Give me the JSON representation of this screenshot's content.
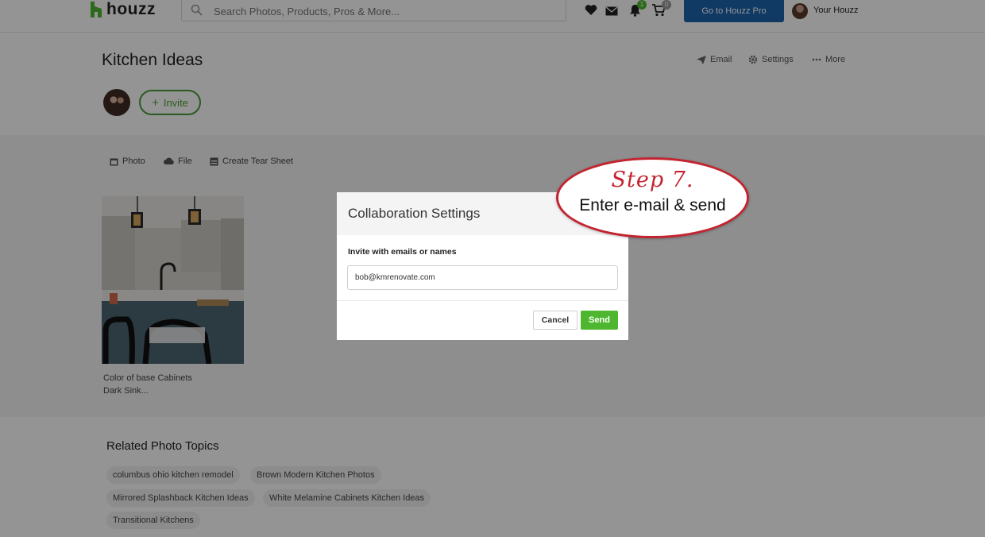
{
  "header": {
    "logo_text": "houzz",
    "search_placeholder": "Search Photos, Products, Pros & More...",
    "notifications_count": "1",
    "cart_count": "0",
    "pro_button": "Go to Houzz Pro",
    "user_label": "Your Houzz"
  },
  "page": {
    "title": "Kitchen Ideas",
    "actions": {
      "email": "Email",
      "settings": "Settings",
      "more": "More"
    },
    "invite_label": "Invite"
  },
  "toolbar": {
    "photo": "Photo",
    "file": "File",
    "tear_sheet": "Create Tear Sheet"
  },
  "photo_card": {
    "caption_line1": "Color of base Cabinets",
    "caption_line2": "Dark Sink..."
  },
  "related": {
    "title": "Related Photo Topics",
    "topics": [
      "columbus ohio kitchen remodel",
      "Brown Modern Kitchen Photos",
      "Mirrored Splashback Kitchen Ideas",
      "White Melamine Cabinets Kitchen Ideas",
      "Transitional Kitchens"
    ]
  },
  "modal": {
    "title": "Collaboration Settings",
    "label": "Invite with emails or names",
    "input_value": "bob@kmrenovate.com",
    "cancel": "Cancel",
    "send": "Send"
  },
  "callout": {
    "step": "Step 7.",
    "text": "Enter e-mail & send"
  },
  "colors": {
    "accent_green": "#4eb72f",
    "pro_blue": "#1d63ad",
    "callout_red": "#c3242f"
  }
}
